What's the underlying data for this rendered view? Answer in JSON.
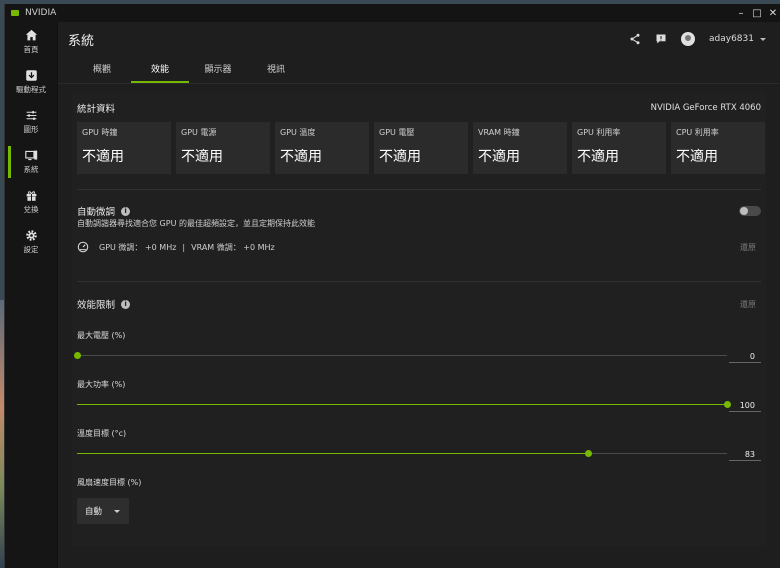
{
  "app": {
    "title": "NVIDIA"
  },
  "colors": {
    "accent": "#76b900",
    "background": "#1e1e1e",
    "card": "#2b2b2b"
  },
  "sidebar": {
    "items": [
      {
        "label": "首頁",
        "icon": "home-icon"
      },
      {
        "label": "驅動程式",
        "icon": "download-icon"
      },
      {
        "label": "圖形",
        "icon": "sliders-icon"
      },
      {
        "label": "系統",
        "icon": "monitor-icon",
        "active": true
      },
      {
        "label": "兌換",
        "icon": "gift-icon"
      },
      {
        "label": "設定",
        "icon": "gear-icon"
      }
    ]
  },
  "header": {
    "title": "系統",
    "username": "aday6831"
  },
  "tabs": [
    {
      "label": "概觀"
    },
    {
      "label": "效能",
      "active": true
    },
    {
      "label": "顯示器"
    },
    {
      "label": "視訊"
    }
  ],
  "stats": {
    "title": "統計資料",
    "gpu_name": "NVIDIA GeForce RTX 4060",
    "cards": [
      {
        "label": "GPU 時鐘",
        "value": "不適用"
      },
      {
        "label": "GPU 電源",
        "value": "不適用"
      },
      {
        "label": "GPU 溫度",
        "value": "不適用"
      },
      {
        "label": "GPU 電壓",
        "value": "不適用"
      },
      {
        "label": "VRAM 時鐘",
        "value": "不適用"
      },
      {
        "label": "GPU 利用率",
        "value": "不適用"
      },
      {
        "label": "CPU 利用率",
        "value": "不適用"
      }
    ]
  },
  "auto_tune": {
    "title": "自動微調",
    "info_glyph": "i",
    "description": "自動調諧器尋找適合您 GPU 的最佳超頻設定，並且定期保持此效能",
    "enabled": false,
    "gpu_offset": "GPU 微調： +0 MHz",
    "separator": "|",
    "vram_offset": "VRAM 微調： +0 MHz",
    "reset_label": "還原"
  },
  "limits": {
    "title": "效能限制",
    "info_glyph": "i",
    "reset_label": "還原",
    "sliders": [
      {
        "label": "最大電壓 (%)",
        "value": "0",
        "fraction": 0.0
      },
      {
        "label": "最大功率 (%)",
        "value": "100",
        "fraction": 1.0
      },
      {
        "label": "溫度目標 (°c)",
        "value": "83",
        "fraction": 0.786
      }
    ],
    "fan": {
      "label": "風扇速度目標 (%)",
      "selected": "自動"
    }
  }
}
